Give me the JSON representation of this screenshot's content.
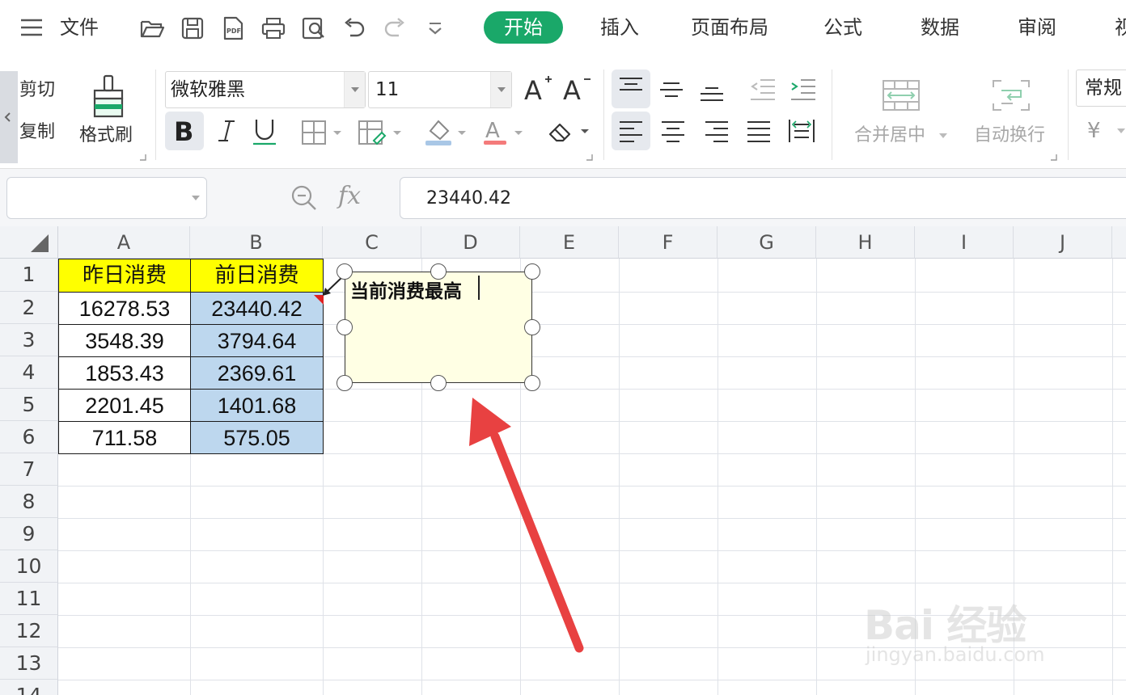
{
  "menu": {
    "file_label": "文件",
    "tabs": [
      {
        "label": "开始",
        "active": true
      },
      {
        "label": "插入"
      },
      {
        "label": "页面布局"
      },
      {
        "label": "公式"
      },
      {
        "label": "数据"
      },
      {
        "label": "审阅"
      },
      {
        "label": "视"
      }
    ],
    "toolbar_icons": [
      "open-folder-icon",
      "save-icon",
      "export-pdf-icon",
      "print-icon",
      "print-preview-icon",
      "undo-icon",
      "redo-icon",
      "more-dropdown-icon"
    ],
    "accent_color": "#1aa869"
  },
  "ribbon": {
    "cut_label": "剪切",
    "copy_label": "复制",
    "format_painter_label": "格式刷",
    "font_name": "微软雅黑",
    "font_size": "11",
    "merge_center_label": "合并居中",
    "wrap_text_label": "自动换行",
    "number_format": "常规",
    "currency_symbol": "¥"
  },
  "formula_bar": {
    "name_box_value": "",
    "fx_label": "fx",
    "formula_value": "23440.42"
  },
  "sheet": {
    "columns": [
      "A",
      "B",
      "C",
      "D",
      "E",
      "F",
      "G",
      "H",
      "I",
      "J"
    ],
    "rows": [
      "1",
      "2",
      "3",
      "4",
      "5",
      "6",
      "7",
      "8",
      "9",
      "10",
      "11",
      "12",
      "13",
      "14"
    ],
    "headers": {
      "A1": "昨日消费",
      "B1": "前日消费"
    },
    "col_a_values": [
      "16278.53",
      "3548.39",
      "1853.43",
      "2201.45",
      "711.58"
    ],
    "col_b_values": [
      "23440.42",
      "3794.64",
      "2369.61",
      "1401.68",
      "575.05"
    ],
    "header_fill": "#ffff00",
    "highlight_fill": "#bdd7ee"
  },
  "textbox": {
    "text": "当前消费最高",
    "fill": "#ffffe4"
  },
  "annotation": {
    "arrow_color": "#e84141"
  },
  "watermark": {
    "main": "Bai 经验",
    "sub": "jingyan.baidu.com"
  }
}
